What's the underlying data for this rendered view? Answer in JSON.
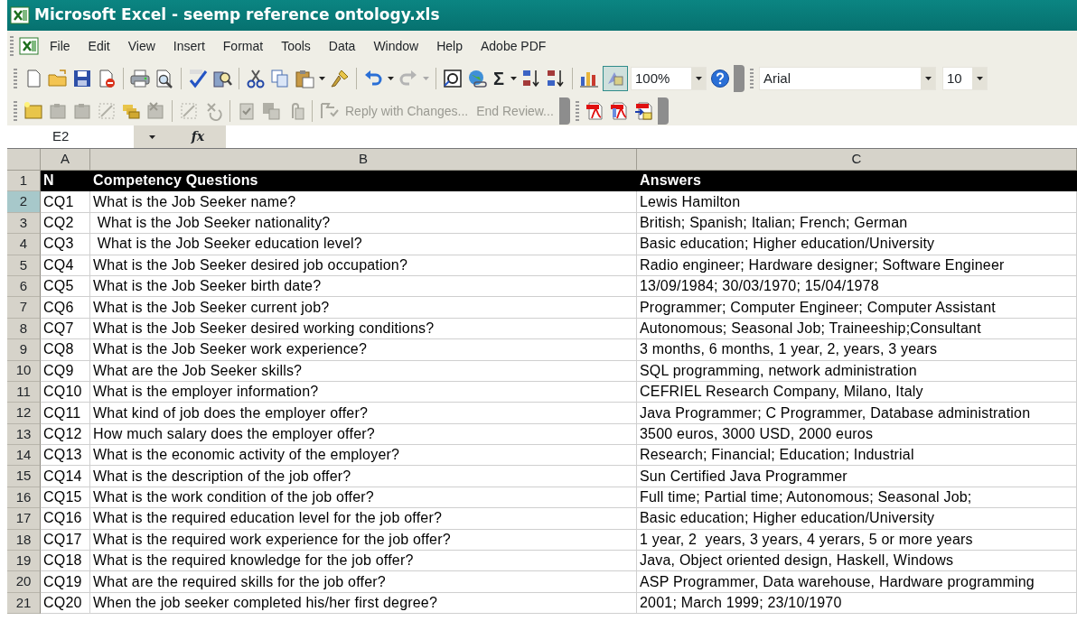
{
  "window": {
    "title": "Microsoft Excel - seemp reference ontology.xls"
  },
  "menu": [
    {
      "label": "File"
    },
    {
      "label": "Edit"
    },
    {
      "label": "View"
    },
    {
      "label": "Insert"
    },
    {
      "label": "Format"
    },
    {
      "label": "Tools"
    },
    {
      "label": "Data"
    },
    {
      "label": "Window"
    },
    {
      "label": "Help"
    },
    {
      "label": "Adobe PDF"
    }
  ],
  "standard_toolbar": {
    "autosum": "Σ",
    "zoom": "100%",
    "drawing_pressed": true
  },
  "formatting_toolbar": {
    "font": "Arial",
    "font_size": "10"
  },
  "reviewing_toolbar": {
    "disabled": true,
    "reply": "Reply with Changes...",
    "end_review": "End Review..."
  },
  "formula_bar": {
    "name_box": "E2",
    "function_label": "fx"
  },
  "sheet": {
    "columns": [
      {
        "label": "A"
      },
      {
        "label": "B"
      },
      {
        "label": "C"
      }
    ],
    "rows": [
      {
        "number": "1",
        "kind": "header",
        "selected": false,
        "cells": [
          "N",
          "Competency Questions",
          "Answers"
        ]
      },
      {
        "number": "2",
        "kind": "data",
        "selected": true,
        "cells": [
          "CQ1",
          "What is the Job Seeker name?",
          "Lewis Hamilton"
        ]
      },
      {
        "number": "3",
        "kind": "data",
        "selected": false,
        "cells": [
          "CQ2",
          " What is the Job Seeker nationality?",
          "British; Spanish; Italian; French; German"
        ]
      },
      {
        "number": "4",
        "kind": "data",
        "selected": false,
        "cells": [
          "CQ3",
          " What is the Job Seeker education level?",
          "Basic education; Higher education/University"
        ]
      },
      {
        "number": "5",
        "kind": "data",
        "selected": false,
        "cells": [
          "CQ4",
          "What is the Job Seeker desired job occupation?",
          "Radio engineer; Hardware designer; Software Engineer"
        ]
      },
      {
        "number": "6",
        "kind": "data",
        "selected": false,
        "cells": [
          "CQ5",
          "What is the Job Seeker birth date?",
          "13/09/1984; 30/03/1970; 15/04/1978"
        ]
      },
      {
        "number": "7",
        "kind": "data",
        "selected": false,
        "cells": [
          "CQ6",
          "What is the Job Seeker current job?",
          "Programmer; Computer Engineer; Computer Assistant"
        ]
      },
      {
        "number": "8",
        "kind": "data",
        "selected": false,
        "cells": [
          "CQ7",
          "What is the Job Seeker desired working conditions?",
          "Autonomous; Seasonal Job; Traineeship;Consultant"
        ]
      },
      {
        "number": "9",
        "kind": "data",
        "selected": false,
        "cells": [
          "CQ8",
          "What is the Job Seeker work experience?",
          "3 months, 6 months, 1 year, 2, years, 3 years"
        ]
      },
      {
        "number": "10",
        "kind": "data",
        "selected": false,
        "cells": [
          "CQ9",
          "What are the Job Seeker skills?",
          "SQL programming, network administration"
        ]
      },
      {
        "number": "11",
        "kind": "data",
        "selected": false,
        "cells": [
          "CQ10",
          "What is the employer information?",
          "CEFRIEL Research Company, Milano, Italy"
        ]
      },
      {
        "number": "12",
        "kind": "data",
        "selected": false,
        "cells": [
          "CQ11",
          "What kind of job does the employer offer?",
          "Java Programmer; C Programmer, Database administration"
        ]
      },
      {
        "number": "13",
        "kind": "data",
        "selected": false,
        "cells": [
          "CQ12",
          "How much salary does the employer offer?",
          "3500 euros, 3000 USD, 2000 euros"
        ]
      },
      {
        "number": "14",
        "kind": "data",
        "selected": false,
        "cells": [
          "CQ13",
          "What is the economic activity of the employer?",
          "Research; Financial; Education; Industrial"
        ]
      },
      {
        "number": "15",
        "kind": "data",
        "selected": false,
        "cells": [
          "CQ14",
          "What is the description of the job offer?",
          "Sun Certified Java Programmer"
        ]
      },
      {
        "number": "16",
        "kind": "data",
        "selected": false,
        "cells": [
          "CQ15",
          "What is the work condition of the job offer?",
          "Full time; Partial time; Autonomous; Seasonal Job;"
        ]
      },
      {
        "number": "17",
        "kind": "data",
        "selected": false,
        "cells": [
          "CQ16",
          "What is the required education level for the job offer?",
          "Basic education; Higher education/University"
        ]
      },
      {
        "number": "18",
        "kind": "data",
        "selected": false,
        "cells": [
          "CQ17",
          "What is the required work experience for the job offer?",
          "1 year, 2  years, 3 years, 4 yerars, 5 or more years"
        ]
      },
      {
        "number": "19",
        "kind": "data",
        "selected": false,
        "cells": [
          "CQ18",
          "What is the required knowledge for the job offer?",
          "Java, Object oriented design, Haskell, Windows"
        ]
      },
      {
        "number": "20",
        "kind": "data",
        "selected": false,
        "cells": [
          "CQ19",
          "What are the required skills for the job offer?",
          "ASP Programmer, Data warehouse, Hardware programming"
        ]
      },
      {
        "number": "21",
        "kind": "data",
        "selected": false,
        "cells": [
          "CQ20",
          "When the job seeker completed his/her first degree?",
          "2001; March 1999; 23/10/1970"
        ]
      }
    ]
  }
}
